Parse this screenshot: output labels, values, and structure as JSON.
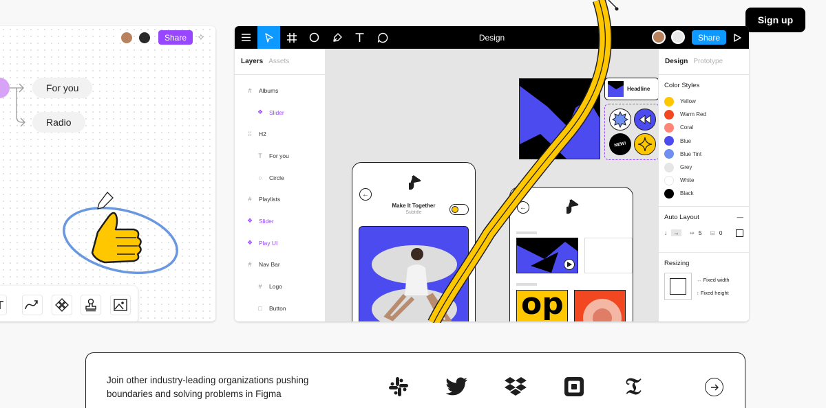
{
  "header": {
    "signup_label": "Sign up"
  },
  "figjam": {
    "share_label": "Share",
    "nodes": [
      "For you",
      "Radio"
    ],
    "tools": [
      "text-tool-icon",
      "connector-tool-icon",
      "component-tool-icon",
      "stamp-tool-icon",
      "image-tool-icon"
    ]
  },
  "editor": {
    "title": "Design",
    "share_label": "Share",
    "toolbar_icons": [
      "menu-icon",
      "move-tool-icon",
      "frame-tool-icon",
      "ellipse-tool-icon",
      "pen-tool-icon",
      "text-tool-icon",
      "comment-tool-icon",
      "present-icon"
    ],
    "layers_panel": {
      "tabs": [
        "Layers",
        "Assets"
      ],
      "items": [
        {
          "label": "Albums",
          "type": "frame"
        },
        {
          "label": "Slider",
          "type": "component"
        },
        {
          "label": "H2",
          "type": "frame-dashed"
        },
        {
          "label": "For you",
          "type": "text"
        },
        {
          "label": "Circle",
          "type": "ellipse"
        },
        {
          "label": "Playlists",
          "type": "frame"
        },
        {
          "label": "Slider",
          "type": "component"
        },
        {
          "label": "Play UI",
          "type": "component"
        },
        {
          "label": "Nav Bar",
          "type": "frame"
        },
        {
          "label": "Logo",
          "type": "frame"
        },
        {
          "label": "Button",
          "type": "rect"
        }
      ]
    },
    "design_panel": {
      "tabs": [
        "Design",
        "Prototype"
      ],
      "color_styles_title": "Color Styles",
      "colors": [
        {
          "name": "Yellow",
          "hex": "#ffc700"
        },
        {
          "name": "Warm Red",
          "hex": "#f24822"
        },
        {
          "name": "Coral",
          "hex": "#ff8577"
        },
        {
          "name": "Blue",
          "hex": "#4b4bf0"
        },
        {
          "name": "Blue Tint",
          "hex": "#6f8ff0"
        },
        {
          "name": "Grey",
          "hex": "#e6e6e6"
        },
        {
          "name": "White",
          "hex": "#ffffff"
        },
        {
          "name": "Black",
          "hex": "#000000"
        }
      ],
      "auto_layout_title": "Auto Layout",
      "auto_layout_minus": "—",
      "spacing": "5",
      "padding": "0",
      "resizing_title": "Resizing",
      "fixed_width": "Fixed width",
      "fixed_height": "Fixed height"
    },
    "canvas": {
      "headline_label": "Headline",
      "badge_label": "NEW!",
      "phone1": {
        "title": "Make It Together",
        "subtitle": "Subtitle"
      },
      "tile_text": "op"
    }
  },
  "card": {
    "text": "Join other industry-leading organizations pushing boundaries and solving problems in Figma",
    "logos": [
      "slack-logo-icon",
      "twitter-logo-icon",
      "dropbox-logo-icon",
      "square-logo-icon",
      "nyt-logo-icon"
    ],
    "next_icon": "arrow-right-icon"
  },
  "colors": {
    "figjam_accent": "#9747ff",
    "figma_blue": "#0d99ff",
    "ribbon_yellow": "#ffc700",
    "art_blue": "#4b4bf0"
  }
}
